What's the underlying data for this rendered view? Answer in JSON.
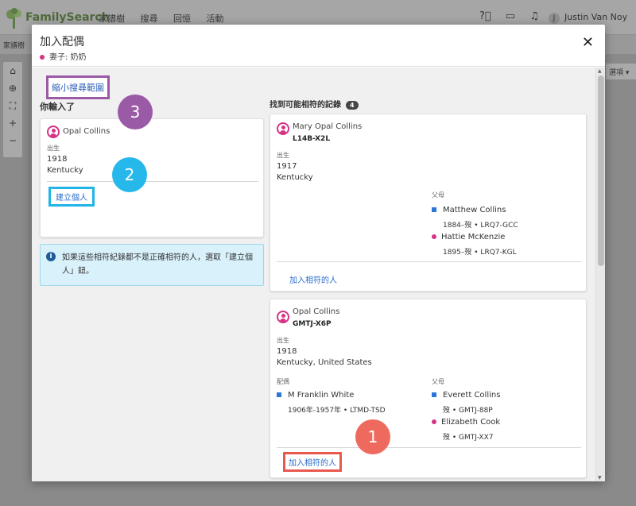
{
  "app": {
    "logo_text": "FamilySearch",
    "nav": [
      "家譜樹",
      "搜尋",
      "回憶",
      "活動"
    ],
    "user_initial": "J",
    "user_name": "Justin Van Noy",
    "subbar_label": "家譜樹",
    "right_select": "選項"
  },
  "modal": {
    "title": "加入配偶",
    "subtitle": "妻子: 奶奶",
    "narrow_search": "縮小搜尋範圍",
    "you_entered_heading": "你輸入了",
    "matches_heading": "找到可能相符的記錄",
    "matches_count": "4",
    "entered": {
      "name": "Opal Collins",
      "birth_label": "出生",
      "birth_year": "1918",
      "birth_place": "Kentucky",
      "create_button": "建立個人"
    },
    "info": "如果這些相符紀錄都不是正確相符的人，選取「建立個人」鈕。",
    "matches": [
      {
        "name": "Mary Opal Collins",
        "pid": "L14B-X2L",
        "birth_label": "出生",
        "birth_year": "1917",
        "birth_place": "Kentucky",
        "parents_label": "父母",
        "father_name": "Matthew Collins",
        "father_detail": "1884–歿 • LRQ7-GCC",
        "mother_name": "Hattie McKenzie",
        "mother_detail": "1895–歿 • LRQ7-KGL",
        "add_button": "加入相符的人"
      },
      {
        "name": "Opal Collins",
        "pid": "GMTJ-X6P",
        "birth_label": "出生",
        "birth_year": "1918",
        "birth_place": "Kentucky, United States",
        "spouse_label": "配偶",
        "spouse_name": "M Franklin White",
        "spouse_detail": "1906年-1957年 • LTMD-TSD",
        "parents_label": "父母",
        "father_name": "Everett Collins",
        "father_detail": "歿 • GMTJ-88P",
        "mother_name": "Elizabeth Cook",
        "mother_detail": "歿 • GMTJ-XX7",
        "add_button": "加入相符的人"
      }
    ]
  },
  "steps": [
    "1",
    "2",
    "3"
  ],
  "colors": {
    "step1": "#ef6a5e",
    "step2": "#26b8ea",
    "step3": "#9b5aa6",
    "female": "#d63384",
    "male": "#2b74d8"
  }
}
